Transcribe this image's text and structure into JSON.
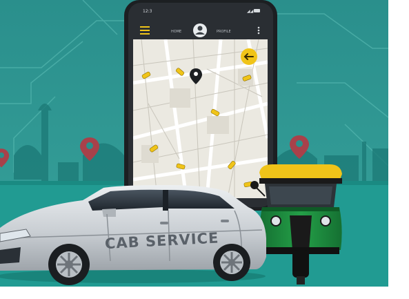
{
  "phone": {
    "status": {
      "time": "12:3",
      "signal": "◢◢"
    },
    "topbar": {
      "left_label": "HOME",
      "right_label": "PROFILE",
      "menu_icon": "hamburger-menu-icon",
      "avatar_icon": "user-avatar-icon",
      "more_icon": "more-vertical-icon"
    },
    "map": {
      "back_button_icon": "arrow-left-icon",
      "pin_icon": "location-pin-icon",
      "taxi_icon": "taxi-icon"
    }
  },
  "cab": {
    "door_text": "CAB SERVICE"
  },
  "colors": {
    "sky_top": "#2a8f8c",
    "sky_bottom": "#37a29b",
    "ground": "#219b92",
    "phone_body": "#1c1f22",
    "map_bg": "#ebe9e1",
    "accent_yellow": "#f0c419",
    "rickshaw_green": "#1e8a3d",
    "pin_red": "#a8414a"
  }
}
